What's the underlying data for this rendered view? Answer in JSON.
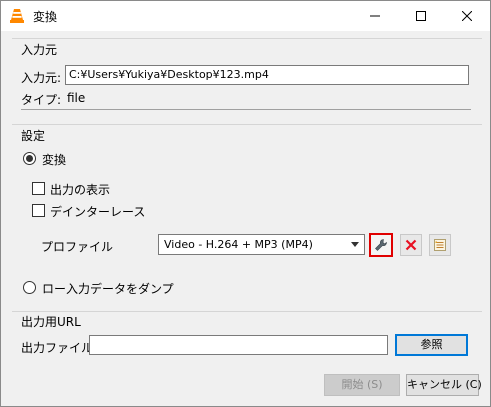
{
  "window": {
    "title": "変換",
    "icon": "vlc-cone-icon",
    "controls": {
      "minimize": "minimize-icon",
      "maximize": "maximize-icon",
      "close": "close-icon"
    }
  },
  "source": {
    "group_title": "入力元",
    "input_label": "入力元:",
    "input_value": "C:¥Users¥Yukiya¥Desktop¥123.mp4",
    "type_label": "タイプ:",
    "type_value": "file"
  },
  "settings": {
    "group_title": "設定",
    "convert_label": "変換",
    "convert_selected": true,
    "show_output_label": "出力の表示",
    "show_output_checked": false,
    "deinterlace_label": "デインターレース",
    "deinterlace_checked": false,
    "profile_label": "プロファイル",
    "profile_value": "Video - H.264 + MP3 (MP4)",
    "dump_label": "ロー入力データをダンプ",
    "dump_selected": false
  },
  "output": {
    "group_title": "出力用URL",
    "file_label": "出力ファイル:",
    "file_value": "",
    "browse_label": "参照"
  },
  "footer": {
    "start_label": "開始 (S)",
    "start_enabled": false,
    "cancel_label": "キャンセル (C)"
  },
  "colors": {
    "delete_red": "#e81123",
    "highlight_red": "#e00000",
    "primary_blue": "#0078d7"
  }
}
